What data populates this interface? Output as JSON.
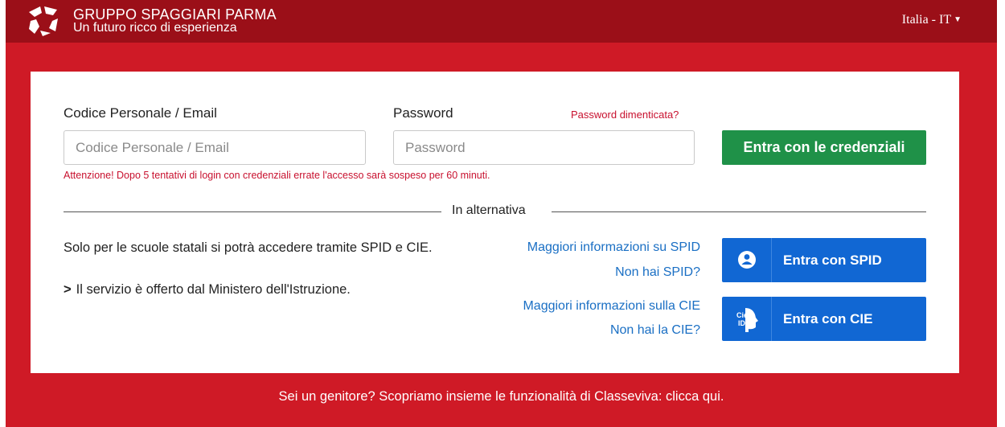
{
  "header": {
    "brand_big": "GRUPPO SPAGGIARI PARMA",
    "brand_sub": "Un futuro ricco di esperienza",
    "language": "Italia - IT"
  },
  "colors": {
    "primary_red": "#cf1a26",
    "header_red": "#9b0f18",
    "login_green": "#1f9148",
    "spid_blue": "#1167d3",
    "link_blue": "#1a6fc4"
  },
  "login": {
    "user_label": "Codice Personale / Email",
    "user_placeholder": "Codice Personale / Email",
    "password_label": "Password",
    "password_placeholder": "Password",
    "forgot_link": "Password dimenticata?",
    "submit_label": "Entra con le credenziali",
    "warning": "Attenzione! Dopo 5 tentativi di login con credenziali errate l'accesso sarà sospeso per 60 minuti."
  },
  "alternative": {
    "divider_text": "In alternativa",
    "info_text": "Solo per le scuole statali si potrà accedere tramite SPID e CIE.",
    "offer_text": "Il servizio è offerto dal Ministero dell'Istruzione.",
    "spid_info_link": "Maggiori informazioni su SPID",
    "spid_missing_link": "Non hai SPID?",
    "cie_info_link": "Maggiori informazioni sulla CIE",
    "cie_missing_link": "Non hai la CIE?",
    "spid_button": "Entra con SPID",
    "cie_button": "Entra con CIE",
    "cie_icon_text": "Cie ID"
  },
  "footer": {
    "text": "Sei un genitore? Scopriamo insieme le funzionalità di Classeviva: clicca qui."
  },
  "icons": [
    "spaggiari-logo-icon",
    "caret-down-icon",
    "chevron-right-icon",
    "spid-user-icon",
    "cie-id-icon"
  ]
}
